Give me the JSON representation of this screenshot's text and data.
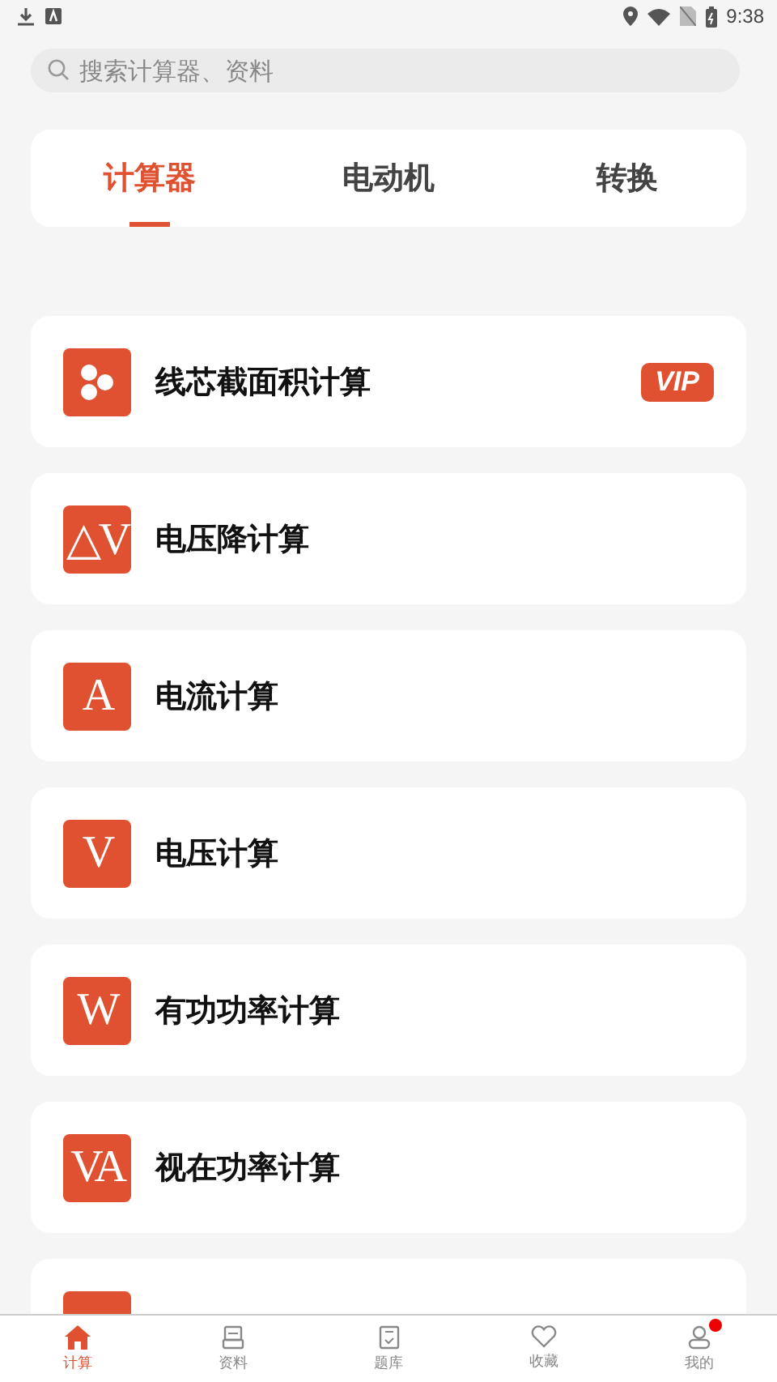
{
  "status_bar": {
    "time": "9:38"
  },
  "search": {
    "placeholder": "搜索计算器、资料"
  },
  "tabs": [
    {
      "label": "计算器",
      "selected": true
    },
    {
      "label": "电动机",
      "selected": false
    },
    {
      "label": "转换",
      "selected": false
    }
  ],
  "calculators": [
    {
      "kind": "dots",
      "title": "线芯截面积计算",
      "badge": "VIP"
    },
    {
      "kind": "glyph",
      "glyph": "△V",
      "title": "电压降计算"
    },
    {
      "kind": "glyph",
      "glyph": "A",
      "title": "电流计算"
    },
    {
      "kind": "glyph",
      "glyph": "V",
      "title": "电压计算"
    },
    {
      "kind": "glyph",
      "glyph": "W",
      "title": "有功功率计算"
    },
    {
      "kind": "glyph",
      "glyph": "VA",
      "title": "视在功率计算"
    },
    {
      "kind": "cut"
    }
  ],
  "nav": [
    {
      "kind": "home",
      "label": "计算",
      "selected": true,
      "dot": false
    },
    {
      "kind": "docs",
      "label": "资料",
      "selected": false,
      "dot": false
    },
    {
      "kind": "quiz",
      "label": "题库",
      "selected": false,
      "dot": false
    },
    {
      "kind": "heart",
      "label": "收藏",
      "selected": false,
      "dot": false
    },
    {
      "kind": "user",
      "label": "我的",
      "selected": false,
      "dot": true
    }
  ]
}
